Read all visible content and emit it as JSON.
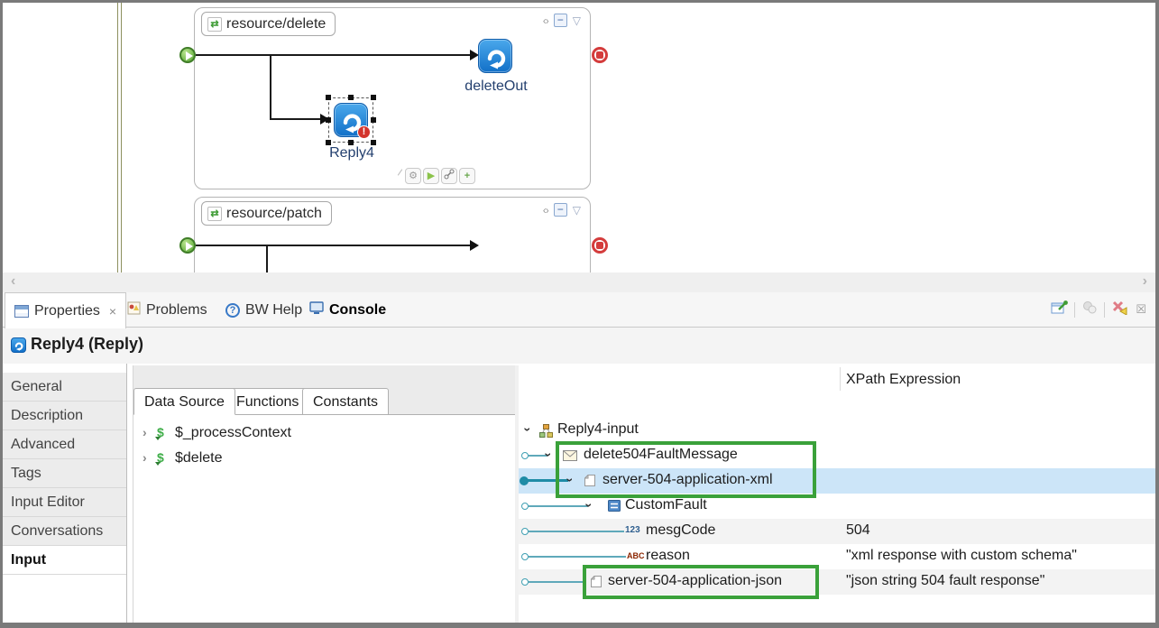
{
  "canvas": {
    "groups": [
      {
        "label": "resource/delete"
      },
      {
        "label": "resource/patch"
      }
    ],
    "activities": [
      {
        "label": "deleteOut"
      },
      {
        "label": "Reply4",
        "selected": true,
        "error": true
      }
    ]
  },
  "view_tabs": {
    "tabs": [
      {
        "label": "Properties",
        "active": true
      },
      {
        "label": "Problems"
      },
      {
        "label": "BW Help"
      },
      {
        "label": "Console",
        "bold": true
      }
    ]
  },
  "properties": {
    "title": "Reply4 (Reply)",
    "sidebar": {
      "items": [
        {
          "label": "General"
        },
        {
          "label": "Description"
        },
        {
          "label": "Advanced"
        },
        {
          "label": "Tags"
        },
        {
          "label": "Input Editor"
        },
        {
          "label": "Conversations"
        },
        {
          "label": "Input",
          "active": true
        }
      ]
    },
    "datasource": {
      "tabs": [
        {
          "label": "Data Source",
          "active": true
        },
        {
          "label": "Functions"
        },
        {
          "label": "Constants"
        }
      ],
      "items": [
        {
          "label": "$_processContext"
        },
        {
          "label": "$delete"
        }
      ]
    },
    "mapping": {
      "column_header": "XPath Expression",
      "rows": [
        {
          "label": "Reply4-input",
          "icon": "tree-root-icon",
          "xpath": ""
        },
        {
          "label": "delete504FaultMessage",
          "icon": "message-icon",
          "xpath": ""
        },
        {
          "label": "server-504-application-xml",
          "icon": "element-icon",
          "xpath": "",
          "selected": true
        },
        {
          "label": "CustomFault",
          "icon": "complex-element-icon",
          "xpath": ""
        },
        {
          "label": "mesgCode",
          "icon": "number-icon",
          "xpath": "504"
        },
        {
          "label": "reason",
          "icon": "string-icon",
          "xpath": "\"xml response with custom schema\""
        },
        {
          "label": "server-504-application-json",
          "icon": "element-icon",
          "xpath": "\"json string 504 fault response\""
        }
      ]
    }
  },
  "colors": {
    "accent_blue_activity": "#1270c8",
    "selection_row": "#cce5f8",
    "annotation_green": "#3aa13a",
    "mapping_teal": "#1f8ca6",
    "error_red": "#d3342c"
  },
  "icons": {
    "collapse_pair": "‹›",
    "minimize": "−",
    "dropdown": "▽",
    "scroll_left": "‹",
    "scroll_right": "›",
    "close": "×",
    "help": "?",
    "gear": "⚙",
    "play": "▶",
    "plus": "+",
    "chevron": "›",
    "dollar": "$",
    "rest": "⇄",
    "num": "123",
    "str": "ABC"
  }
}
